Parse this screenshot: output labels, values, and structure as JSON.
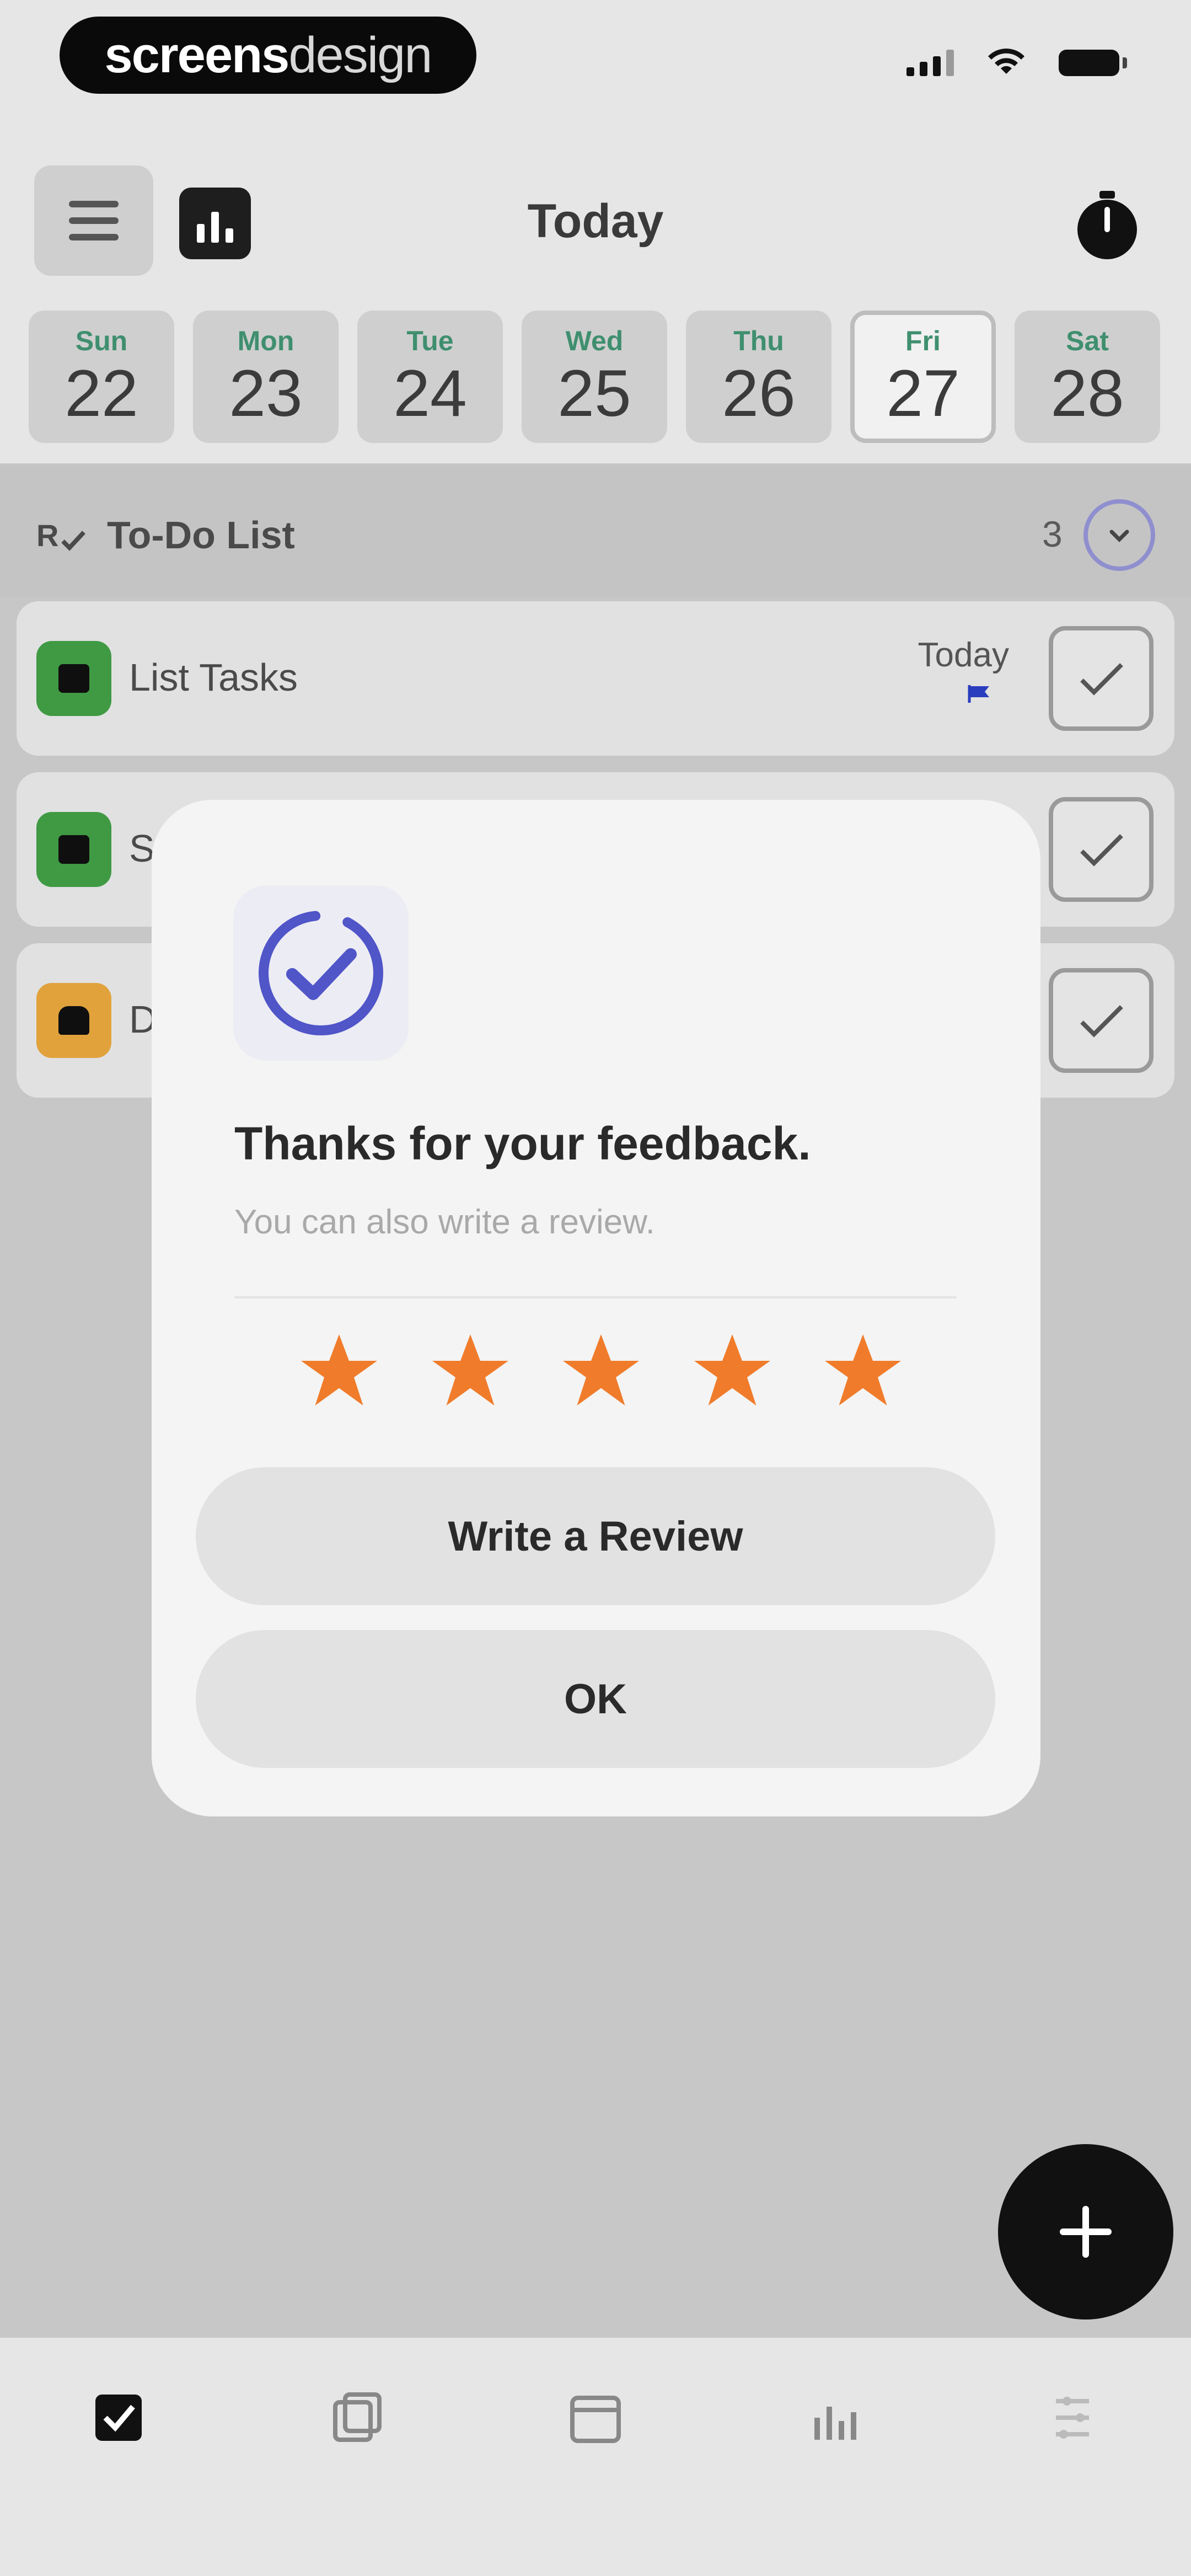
{
  "status_bar": {
    "brand_bold": "screens",
    "brand_light": "design"
  },
  "header": {
    "title": "Today"
  },
  "days": [
    {
      "name": "Sun",
      "num": "22"
    },
    {
      "name": "Mon",
      "num": "23"
    },
    {
      "name": "Tue",
      "num": "24"
    },
    {
      "name": "Wed",
      "num": "25"
    },
    {
      "name": "Thu",
      "num": "26"
    },
    {
      "name": "Fri",
      "num": "27"
    },
    {
      "name": "Sat",
      "num": "28"
    }
  ],
  "selected_day": "27",
  "section": {
    "title": "To-Do List",
    "count": "3"
  },
  "tasks": [
    {
      "label": "List Tasks",
      "due": "Today",
      "icon_color": "#3f9a43"
    },
    {
      "label": "S",
      "due": "",
      "icon_color": "#3f9a43"
    },
    {
      "label": "D",
      "due": "",
      "icon_color": "#e1a23c"
    }
  ],
  "dialog": {
    "title": "Thanks for your feedback.",
    "subtitle": "You can also write a review.",
    "rating": 5,
    "rating_max": 5,
    "write_review_label": "Write a Review",
    "ok_label": "OK"
  },
  "colors": {
    "accent": "#5055c8",
    "star": "#f07c2b",
    "day_name": "#3f8f6f",
    "fab": "#111111"
  },
  "icons": {
    "menu": "hamburger-icon",
    "stats": "bar-chart-icon",
    "timer": "stopwatch-icon",
    "section": "checklist-icon",
    "toggle": "chevron-down-icon",
    "check": "checkmark-icon",
    "flag": "flag-icon",
    "fab": "plus-icon",
    "tabs": [
      "tasks-tab-icon",
      "notes-tab-icon",
      "calendar-tab-icon",
      "stats-tab-icon",
      "settings-tab-icon"
    ]
  }
}
